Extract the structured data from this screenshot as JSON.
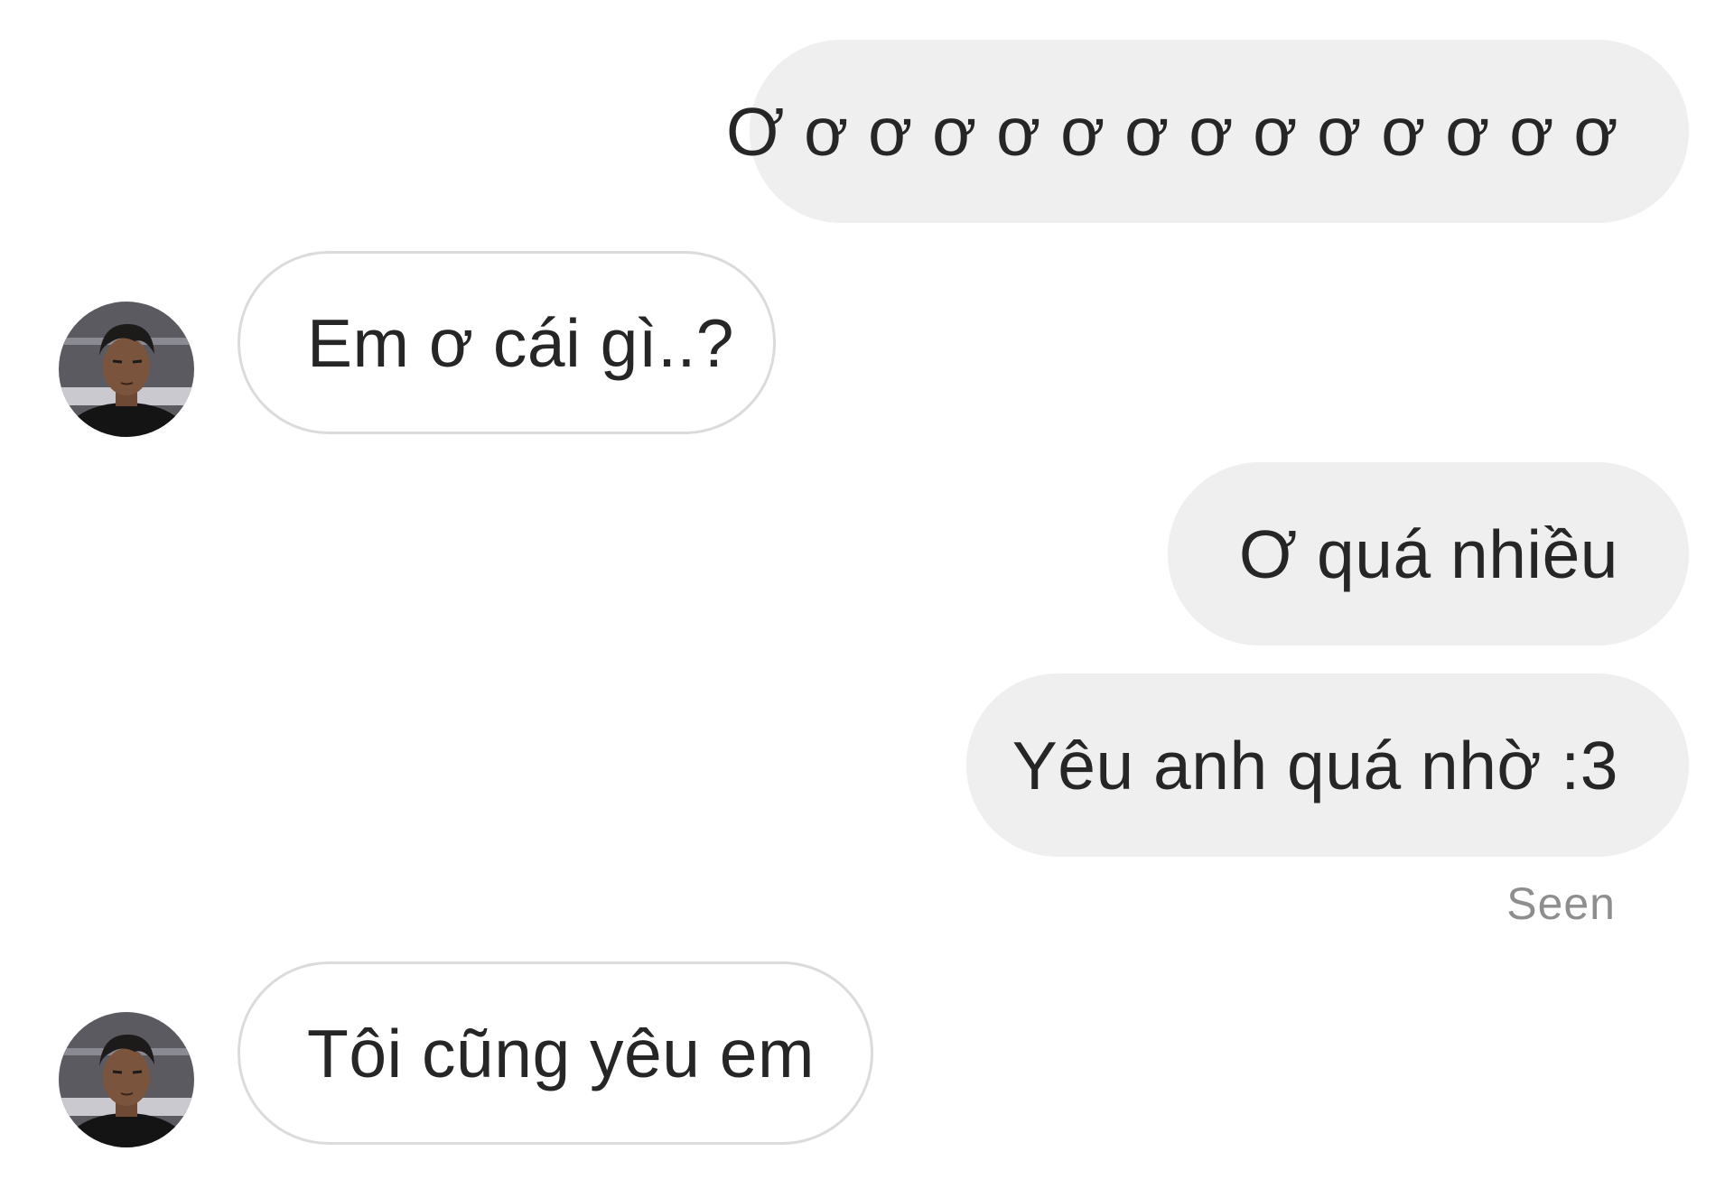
{
  "conversation": {
    "messages": [
      {
        "sender": "me",
        "text": "Ơ ơ ơ ơ ơ ơ ơ ơ ơ ơ ơ ơ ơ ơ"
      },
      {
        "sender": "other",
        "text": "Em ơ cái gì..?"
      },
      {
        "sender": "me",
        "text": "Ơ quá nhiều"
      },
      {
        "sender": "me",
        "text": "Yêu anh quá nhờ :3"
      },
      {
        "sender": "other",
        "text": "Tôi cũng yêu em"
      }
    ],
    "seen_label": "Seen"
  },
  "colors": {
    "sent_bubble": "#efefef",
    "received_border": "#dbdbdb",
    "text": "#262626",
    "seen_text": "#8e8e8e"
  },
  "icons": {
    "avatar": "contact-avatar-icon"
  }
}
